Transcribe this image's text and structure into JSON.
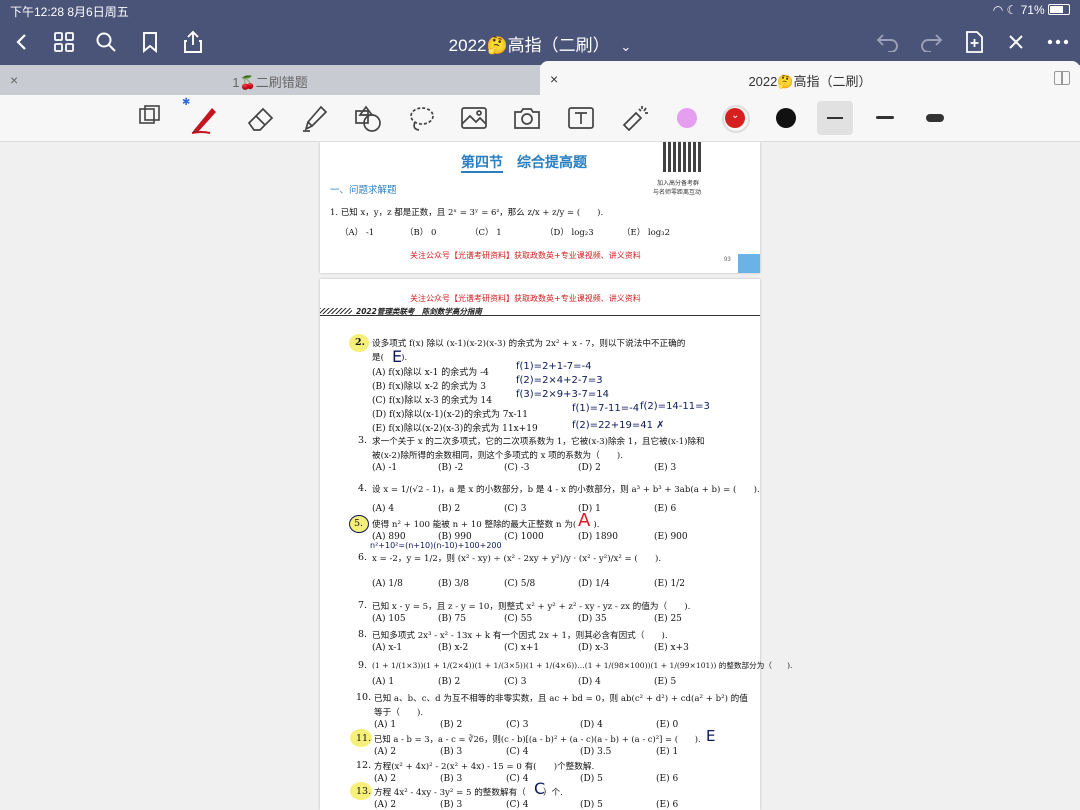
{
  "status": {
    "left": "下午12:28   8月6日周五",
    "right": "71%"
  },
  "nav": {
    "title": "2022🤔高指（二刷）",
    "chevron": "⌄"
  },
  "tabs": [
    {
      "label": "1🍒二刷错题",
      "close": "×"
    },
    {
      "label": "2022🤔高指（二刷）",
      "close": "×"
    }
  ],
  "colors": {
    "pink": "#e59ef0",
    "red": "#d62020",
    "black": "#111111",
    "accent": "#4a5378"
  },
  "page1": {
    "section": "第四节　综合提高题",
    "qr_caption_1": "加入高分备考群",
    "qr_caption_2": "与名师零距离互动",
    "heading": "一、问题求解题",
    "q1": "1. 已知 x，y，z 都是正数，且 2ˣ = 3ʸ = 6ᶻ，那么 z/x + z/y = (　　).",
    "q1_opts": [
      "（A） -1",
      "（B） 0",
      "（C） 1",
      "（D） log₂3",
      "（E） log₃2"
    ],
    "footer": "关注公众号【光谱考研资料】获取政数英+专业课视频、讲义资料",
    "pagenum": "93"
  },
  "page2": {
    "header": "关注公众号【光谱考研资料】获取政数英+专业课视频、讲义资料",
    "subheader": "2022管理类联考　陈剑数学高分指南",
    "questions": [
      {
        "n": "2.",
        "text": "设多项式 f(x) 除以 (x-1)(x-2)(x-3) 的余式为 2x² + x - 7，则以下说法中不正确的",
        "text2": "是(　　).",
        "opts": [
          "(A) f(x)除以 x-1 的余式为 -4",
          "(B) f(x)除以 x-2 的余式为 3",
          "(C) f(x)除以 x-3 的余式为 14",
          "(D) f(x)除以(x-1)(x-2)的余式为 7x-11",
          "(E) f(x)除以(x-2)(x-3)的余式为 11x+19"
        ]
      },
      {
        "n": "3.",
        "text": "求一个关于 x 的二次多项式，它的二次项系数为 1，它被(x-3)除余 1，且它被(x-1)除和",
        "text2": "被(x-2)除所得的余数相同，则这个多项式的 x 项的系数为（　　).",
        "opts": [
          "(A) -1",
          "(B) -2",
          "(C) -3",
          "(D) 2",
          "(E) 3"
        ]
      },
      {
        "n": "4.",
        "text": "设 x = 1/(√2 - 1)，a 是 x 的小数部分，b 是 4 - x 的小数部分，则 a³ + b³ + 3ab(a + b) = (　　).",
        "opts": [
          "(A) 4",
          "(B) 2",
          "(C) 3",
          "(D) 1",
          "(E) 6"
        ]
      },
      {
        "n": "5.",
        "text": "使得 n² + 100 能被 n + 10 整除的最大正整数 n 为(　　).",
        "opts": [
          "(A) 890",
          "(B) 990",
          "(C) 1000",
          "(D) 1890",
          "(E) 900"
        ]
      },
      {
        "n": "6.",
        "text": "x = -2，y = 1/2，则 (x² - xy) ÷ (x² - 2xy + y²)/y · (x² - y²)/x² = (　　).",
        "opts": [
          "(A) 1/8",
          "(B) 3/8",
          "(C) 5/8",
          "(D) 1/4",
          "(E) 1/2"
        ]
      },
      {
        "n": "7.",
        "text": "已知 x - y = 5，且 z - y = 10，则整式 x² + y² + z² - xy - yz - zx 的值为（　　).",
        "opts": [
          "(A) 105",
          "(B) 75",
          "(C) 55",
          "(D) 35",
          "(E) 25"
        ]
      },
      {
        "n": "8.",
        "text": "已知多项式 2x³ - x² - 13x + k 有一个因式 2x + 1，则其必含有因式（　　).",
        "opts": [
          "(A) x-1",
          "(B) x-2",
          "(C) x+1",
          "(D) x-3",
          "(E) x+3"
        ]
      },
      {
        "n": "9.",
        "text": "(1 + 1/(1×3))(1 + 1/(2×4))(1 + 1/(3×5))(1 + 1/(4×6))…(1 + 1/(98×100))(1 + 1/(99×101)) 的整数部分为（　　).",
        "opts": [
          "(A) 1",
          "(B) 2",
          "(C) 3",
          "(D) 4",
          "(E) 5"
        ]
      },
      {
        "n": "10.",
        "text": "已知 a、b、c、d 为互不相等的非零实数，且 ac + bd = 0，则 ab(c² + d²) + cd(a² + b²) 的值",
        "text2": "等于（　　).",
        "opts": [
          "(A) 1",
          "(B) 2",
          "(C) 3",
          "(D) 4",
          "(E) 0"
        ]
      },
      {
        "n": "11.",
        "text": "已知 a - b = 3，a - c = ∛26，则(c - b)[(a - b)² + (a - c)(a - b) + (a - c)²] = (　　).",
        "opts": [
          "(A) 2",
          "(B) 3",
          "(C) 4",
          "(D) 3.5",
          "(E) 1"
        ]
      },
      {
        "n": "12.",
        "text": "方程(x² + 4x)² - 2(x² + 4x) - 15 = 0 有(　　)个整数解.",
        "opts": [
          "(A) 2",
          "(B) 3",
          "(C) 4",
          "(D) 5",
          "(E) 6"
        ]
      },
      {
        "n": "13.",
        "text": "方程 4x² - 4xy - 3y² = 5 的整数解有（　　）个.",
        "opts": [
          "(A) 2",
          "(B) 3",
          "(C) 4",
          "(D) 5",
          "(E) 6"
        ]
      }
    ],
    "handwriting": {
      "q2_answer": "E",
      "q2_a": "f(1)=2+1-7=-4",
      "q2_b": "f(2)=2×4+2-7=3",
      "q2_c": "f(3)=2×9+3-7=14",
      "q2_d1": "f(1)=7-11=-4",
      "q2_d2": "f(2)=14-11=3",
      "q2_e": "f(2)=22+19=41 ✗",
      "q5_answer": "A",
      "q5_work": "n²+10²=(n+10)(n-10)+100+200",
      "q11_answer": "E",
      "q13_answer": "C"
    }
  }
}
